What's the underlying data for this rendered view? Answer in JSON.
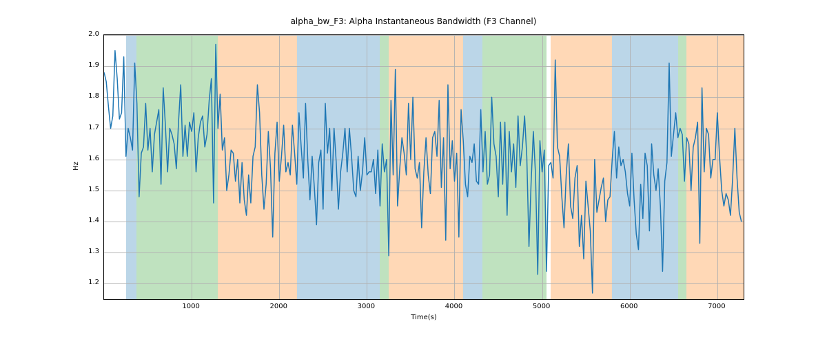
{
  "chart_data": {
    "type": "line",
    "title": "alpha_bw_F3: Alpha Instantaneous Bandwidth (F3 Channel)",
    "xlabel": "Time(s)",
    "ylabel": "Hz",
    "xlim": [
      0,
      7300
    ],
    "ylim": [
      1.15,
      2.0
    ],
    "xticks": [
      1000,
      2000,
      3000,
      4000,
      5000,
      6000,
      7000
    ],
    "yticks": [
      1.2,
      1.3,
      1.4,
      1.5,
      1.6,
      1.7,
      1.8,
      1.9,
      2.0
    ],
    "grid": true,
    "bands": [
      {
        "start": 250,
        "end": 370,
        "color": "blue"
      },
      {
        "start": 370,
        "end": 1300,
        "color": "green"
      },
      {
        "start": 1300,
        "end": 2200,
        "color": "orange"
      },
      {
        "start": 2200,
        "end": 3150,
        "color": "blue"
      },
      {
        "start": 3150,
        "end": 3250,
        "color": "green"
      },
      {
        "start": 3250,
        "end": 4100,
        "color": "orange"
      },
      {
        "start": 4100,
        "end": 4320,
        "color": "blue"
      },
      {
        "start": 4320,
        "end": 5050,
        "color": "green"
      },
      {
        "start": 5100,
        "end": 5800,
        "color": "orange"
      },
      {
        "start": 5800,
        "end": 6550,
        "color": "blue"
      },
      {
        "start": 6550,
        "end": 6650,
        "color": "green"
      },
      {
        "start": 6650,
        "end": 7300,
        "color": "orange"
      }
    ],
    "series": [
      {
        "name": "alpha_bw_F3",
        "color": "#1f77b4",
        "x_step": 25,
        "x_start": 0,
        "values": [
          1.88,
          1.85,
          1.77,
          1.7,
          1.74,
          1.95,
          1.86,
          1.73,
          1.75,
          1.93,
          1.61,
          1.7,
          1.67,
          1.63,
          1.91,
          1.78,
          1.48,
          1.62,
          1.64,
          1.78,
          1.63,
          1.7,
          1.56,
          1.68,
          1.72,
          1.76,
          1.52,
          1.83,
          1.71,
          1.56,
          1.7,
          1.68,
          1.65,
          1.57,
          1.72,
          1.84,
          1.61,
          1.71,
          1.61,
          1.72,
          1.69,
          1.75,
          1.56,
          1.67,
          1.72,
          1.74,
          1.64,
          1.68,
          1.79,
          1.86,
          1.46,
          1.97,
          1.7,
          1.81,
          1.63,
          1.67,
          1.5,
          1.55,
          1.63,
          1.62,
          1.53,
          1.6,
          1.46,
          1.59,
          1.47,
          1.42,
          1.55,
          1.46,
          1.61,
          1.64,
          1.84,
          1.75,
          1.55,
          1.44,
          1.52,
          1.69,
          1.57,
          1.35,
          1.62,
          1.72,
          1.53,
          1.61,
          1.71,
          1.56,
          1.59,
          1.55,
          1.71,
          1.62,
          1.52,
          1.75,
          1.64,
          1.54,
          1.78,
          1.6,
          1.47,
          1.61,
          1.51,
          1.39,
          1.59,
          1.63,
          1.44,
          1.78,
          1.62,
          1.7,
          1.5,
          1.7,
          1.59,
          1.44,
          1.56,
          1.62,
          1.7,
          1.56,
          1.7,
          1.61,
          1.5,
          1.48,
          1.61,
          1.5,
          1.56,
          1.67,
          1.55,
          1.56,
          1.56,
          1.6,
          1.49,
          1.63,
          1.45,
          1.65,
          1.56,
          1.6,
          1.29,
          1.79,
          1.55,
          1.89,
          1.45,
          1.57,
          1.67,
          1.62,
          1.55,
          1.78,
          1.6,
          1.8,
          1.57,
          1.54,
          1.59,
          1.38,
          1.56,
          1.67,
          1.55,
          1.49,
          1.67,
          1.69,
          1.61,
          1.79,
          1.51,
          1.67,
          1.34,
          1.84,
          1.57,
          1.66,
          1.53,
          1.62,
          1.35,
          1.76,
          1.66,
          1.52,
          1.48,
          1.61,
          1.59,
          1.65,
          1.53,
          1.52,
          1.76,
          1.56,
          1.69,
          1.52,
          1.55,
          1.8,
          1.65,
          1.61,
          1.48,
          1.72,
          1.52,
          1.72,
          1.42,
          1.69,
          1.56,
          1.65,
          1.51,
          1.74,
          1.58,
          1.64,
          1.74,
          1.61,
          1.32,
          1.53,
          1.69,
          1.55,
          1.23,
          1.66,
          1.56,
          1.63,
          1.24,
          1.58,
          1.59,
          1.54,
          1.92,
          1.64,
          1.61,
          1.48,
          1.38,
          1.55,
          1.65,
          1.45,
          1.41,
          1.54,
          1.58,
          1.32,
          1.42,
          1.28,
          1.53,
          1.45,
          1.37,
          1.17,
          1.6,
          1.43,
          1.47,
          1.51,
          1.54,
          1.4,
          1.47,
          1.48,
          1.6,
          1.69,
          1.54,
          1.64,
          1.58,
          1.6,
          1.56,
          1.49,
          1.45,
          1.62,
          1.47,
          1.36,
          1.31,
          1.52,
          1.41,
          1.62,
          1.58,
          1.37,
          1.65,
          1.55,
          1.5,
          1.57,
          1.45,
          1.24,
          1.53,
          1.59,
          1.91,
          1.61,
          1.68,
          1.75,
          1.67,
          1.7,
          1.68,
          1.53,
          1.67,
          1.65,
          1.5,
          1.64,
          1.67,
          1.72,
          1.33,
          1.83,
          1.56,
          1.7,
          1.68,
          1.54,
          1.6,
          1.6,
          1.75,
          1.61,
          1.5,
          1.45,
          1.49,
          1.47,
          1.42,
          1.54,
          1.7,
          1.54,
          1.43,
          1.4
        ]
      }
    ]
  }
}
